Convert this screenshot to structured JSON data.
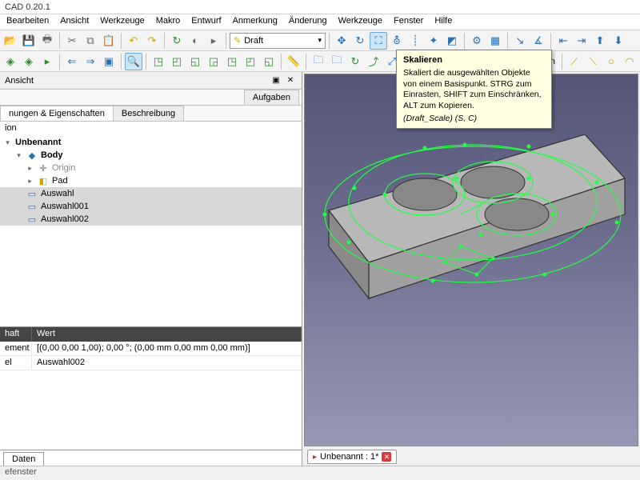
{
  "title": "CAD 0.20.1",
  "menus": [
    "Bearbeiten",
    "Ansicht",
    "Werkzeuge",
    "Makro",
    "Entwurf",
    "Anmerkung",
    "Änderung",
    "Werkzeuge",
    "Fenster",
    "Hilfe"
  ],
  "workbench": {
    "selected": "Draft"
  },
  "kein_label": "Kein",
  "tooltip": {
    "title": "Skalieren",
    "body": "Skaliert die ausgewählten Objekte von einem Basispunkt. STRG zum Einrasten, SHIFT zum Einschränken, ALT zum Kopieren.",
    "cmd": "(Draft_Scale) (S, C)"
  },
  "combo": {
    "title": "Ansicht",
    "tabs": {
      "tasks": "Aufgaben"
    },
    "subtabs": {
      "props": "nungen & Eigenschaften",
      "desc": "Beschreibung"
    },
    "section": "ion"
  },
  "tree": {
    "doc": "Unbenannt",
    "body": "Body",
    "origin": "Origin",
    "pad": "Pad",
    "auswahl": "Auswahl",
    "auswahl001": "Auswahl001",
    "auswahl002": "Auswahl002"
  },
  "props": {
    "headers": {
      "key": "haft",
      "val": "Wert"
    },
    "rows": [
      {
        "k": "ement",
        "v": "[(0,00 0,00 1,00); 0,00 °; (0,00 mm  0,00 mm  0,00 mm)]"
      },
      {
        "k": "el",
        "v": "Auswahl002"
      }
    ],
    "bottom_tab": "Daten"
  },
  "doc_tab": {
    "label": "Unbenannt : 1*"
  },
  "status": "efenster"
}
